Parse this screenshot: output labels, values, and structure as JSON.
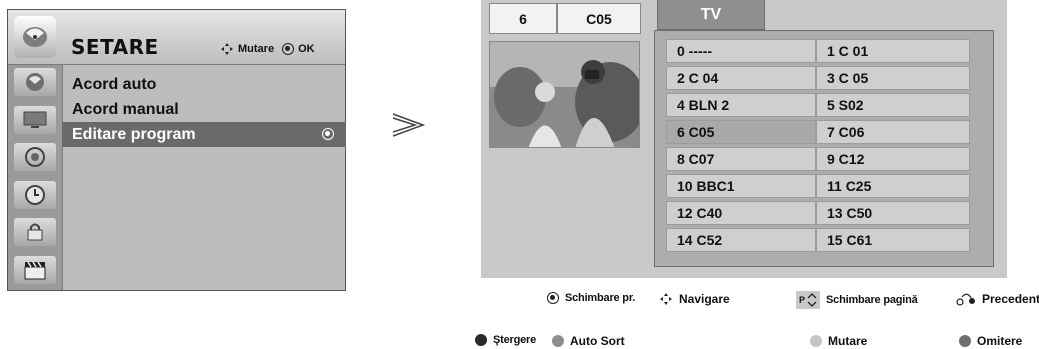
{
  "menu": {
    "title": "SETARE",
    "hint_move": "Mutare",
    "hint_ok": "OK",
    "items": [
      {
        "label": "Acord auto",
        "selected": false
      },
      {
        "label": "Acord manual",
        "selected": false
      },
      {
        "label": "Editare program",
        "selected": true
      }
    ],
    "side_icons": [
      "satellite-dish-icon",
      "monitor-icon",
      "speaker-icon",
      "clock-icon",
      "lock-icon",
      "clapperboard-icon"
    ]
  },
  "editor": {
    "current_number": "6",
    "current_name": "C05",
    "tab": "TV",
    "programs": [
      {
        "left": "0 -----",
        "right": "1 C 01"
      },
      {
        "left": "2 C 04",
        "right": "3 C 05"
      },
      {
        "left": "4 BLN 2",
        "right": "5 S02"
      },
      {
        "left": "6 C05",
        "right": "7 C06"
      },
      {
        "left": "8 C07",
        "right": "9 C12"
      },
      {
        "left": "10 BBC1",
        "right": "11 C25"
      },
      {
        "left": "12 C40",
        "right": "13 C50"
      },
      {
        "left": "14 C52",
        "right": "15 C61"
      }
    ],
    "highlighted": "6 C05"
  },
  "footer": {
    "row1": {
      "change_pr": "Schimbare pr.",
      "navigate": "Navigare",
      "page_key": "P",
      "page_change": "Schimbare pagină",
      "previous": "Precedent"
    },
    "row2": {
      "delete": "Ştergere",
      "auto_sort": "Auto Sort",
      "move": "Mutare",
      "skip": "Omitere"
    }
  },
  "colors": {
    "red": "#2b2b2b",
    "green": "#8e8e8e",
    "yellow": "#c4c4c4",
    "blue": "#6f6f6f"
  }
}
